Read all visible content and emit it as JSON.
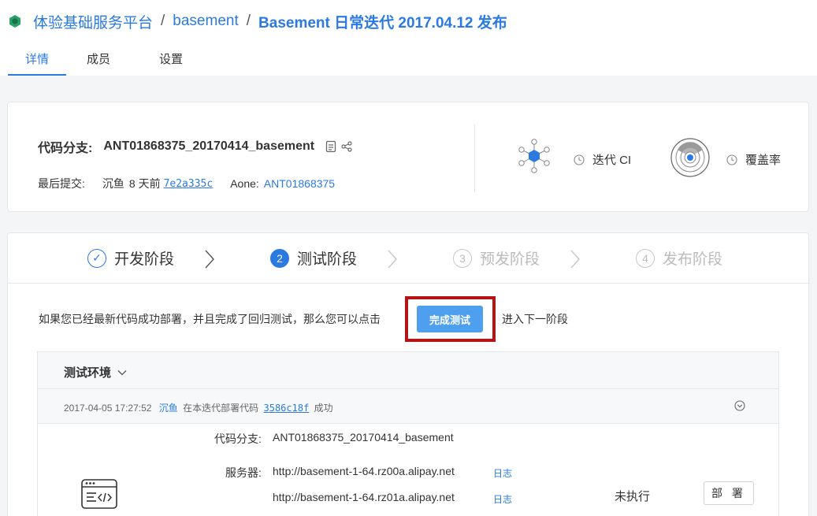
{
  "breadcrumb": {
    "platform": "体验基础服务平台",
    "repo": "basement",
    "release": "Basement 日常迭代 2017.04.12 发布",
    "separator": "/"
  },
  "tabs": [
    {
      "label": "详情",
      "active": true
    },
    {
      "label": "成员",
      "active": false
    },
    {
      "label": "设置",
      "active": false
    }
  ],
  "branch": {
    "label": "代码分支:",
    "name": "ANT01868375_20170414_basement",
    "last_commit_label": "最后提交:",
    "author": "沉鱼",
    "time": "8 天前",
    "commit_hash": "7e2a335c",
    "aone_label": "Aone:",
    "aone_id": "ANT01868375"
  },
  "metrics": {
    "ci_label": "迭代 CI",
    "coverage_label": "覆盖率"
  },
  "steps": [
    {
      "num": "✓",
      "label": "开发阶段",
      "state": "done"
    },
    {
      "num": "2",
      "label": "测试阶段",
      "state": "active"
    },
    {
      "num": "3",
      "label": "预发阶段",
      "state": "pending"
    },
    {
      "num": "4",
      "label": "发布阶段",
      "state": "pending"
    }
  ],
  "instruction": {
    "text": "如果您已经最新代码成功部署，并且完成了回归测试，那么您可以点击",
    "button": "完成测试",
    "suffix": "进入下一阶段"
  },
  "environment": {
    "title": "测试环境",
    "deploy_time": "2017-04-05 17:27:52",
    "deploy_user": "沉鱼",
    "deploy_text": "在本迭代部署代码",
    "deploy_hash": "3586c18f",
    "deploy_result": "成功",
    "branch_label": "代码分支:",
    "branch_value": "ANT01868375_20170414_basement",
    "server_label": "服务器:",
    "servers": [
      "http://basement-1-64.rz00a.alipay.net",
      "http://basement-1-64.rz01a.alipay.net"
    ],
    "log_label": "日志",
    "status": "未执行",
    "deploy_button": "部 署"
  },
  "colors": {
    "accent": "#2a7ae2",
    "button": "#4ea0ee",
    "highlight": "#b41414",
    "logo": "#27a36a"
  }
}
